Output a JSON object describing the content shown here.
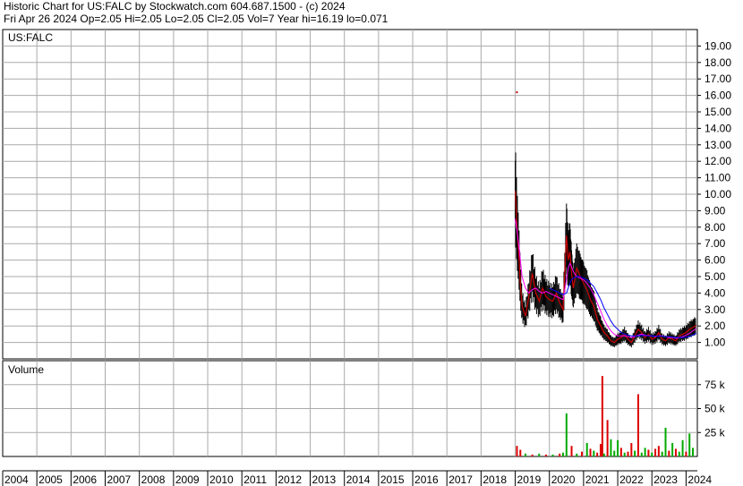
{
  "header": {
    "line1": "Historic Chart for US:FALC by Stockwatch.com 604.687.1500 - (c) 2024",
    "line2": "Fri Apr 26 2024   Op=2.05  Hi=2.05  Lo=2.05  Cl=2.05  Vol=7   Year hi=16.19  lo=0.071"
  },
  "chart_data": [
    {
      "type": "line",
      "title": "US:FALC",
      "ylim": [
        0,
        20
      ],
      "yticks": [
        "1.00",
        "2.00",
        "3.00",
        "4.00",
        "5.00",
        "6.00",
        "7.00",
        "8.00",
        "9.00",
        "10.00",
        "11.00",
        "12.00",
        "13.00",
        "14.00",
        "15.00",
        "16.00",
        "17.00",
        "18.00",
        "19.00"
      ],
      "x": [
        2019.0,
        2019.05,
        2019.1,
        2019.15,
        2019.2,
        2019.3,
        2019.4,
        2019.5,
        2019.6,
        2019.7,
        2019.8,
        2019.9,
        2020.0,
        2020.1,
        2020.2,
        2020.3,
        2020.4,
        2020.5,
        2020.55,
        2020.6,
        2020.65,
        2020.7,
        2020.8,
        2020.9,
        2021.0,
        2021.1,
        2021.2,
        2021.3,
        2021.4,
        2021.5,
        2021.6,
        2021.7,
        2021.8,
        2021.9,
        2022.0,
        2022.1,
        2022.2,
        2022.3,
        2022.4,
        2022.5,
        2022.6,
        2022.7,
        2022.8,
        2022.9,
        2023.0,
        2023.1,
        2023.2,
        2023.3,
        2023.4,
        2023.5,
        2023.6,
        2023.7,
        2023.8,
        2023.9,
        2024.0,
        2024.1,
        2024.2,
        2024.3
      ],
      "series": [
        {
          "values": [
            10.2,
            8.0,
            6.5,
            4.5,
            3.2,
            2.6,
            3.8,
            5.2,
            4.0,
            3.5,
            4.3,
            3.8,
            3.6,
            3.5,
            4.0,
            3.4,
            3.0,
            7.5,
            6.0,
            6.5,
            5.2,
            4.3,
            5.5,
            5.0,
            4.6,
            4.2,
            3.6,
            3.2,
            2.4,
            2.0,
            1.6,
            1.4,
            1.1,
            1.0,
            1.2,
            1.3,
            1.5,
            1.2,
            1.0,
            1.4,
            1.8,
            1.6,
            1.3,
            1.5,
            1.2,
            1.3,
            1.6,
            1.2,
            1.1,
            1.3,
            1.2,
            1.1,
            1.4,
            1.5,
            1.6,
            1.8,
            1.9,
            2.05
          ]
        },
        {
          "values": [
            8.5,
            7.8,
            7.0,
            6.0,
            5.0,
            4.3,
            4.0,
            4.2,
            4.3,
            4.1,
            4.0,
            4.1,
            4.0,
            3.9,
            3.8,
            3.7,
            3.6,
            4.8,
            5.5,
            5.8,
            5.6,
            5.3,
            5.0,
            4.9,
            4.8,
            4.6,
            4.3,
            3.9,
            3.4,
            2.9,
            2.4,
            2.0,
            1.7,
            1.5,
            1.4,
            1.4,
            1.4,
            1.35,
            1.3,
            1.35,
            1.45,
            1.5,
            1.45,
            1.4,
            1.4,
            1.35,
            1.4,
            1.4,
            1.35,
            1.3,
            1.3,
            1.25,
            1.3,
            1.35,
            1.45,
            1.55,
            1.7,
            1.85
          ]
        },
        {
          "values": [
            null,
            null,
            null,
            null,
            null,
            null,
            null,
            null,
            null,
            null,
            null,
            null,
            4.3,
            4.2,
            4.1,
            4.0,
            3.9,
            4.0,
            4.3,
            4.6,
            4.8,
            4.9,
            5.0,
            5.0,
            4.9,
            4.8,
            4.6,
            4.4,
            4.0,
            3.6,
            3.1,
            2.7,
            2.3,
            2.0,
            1.8,
            1.6,
            1.5,
            1.45,
            1.4,
            1.4,
            1.4,
            1.42,
            1.42,
            1.4,
            1.4,
            1.38,
            1.38,
            1.38,
            1.36,
            1.34,
            1.32,
            1.3,
            1.3,
            1.3,
            1.32,
            1.36,
            1.45,
            1.55
          ]
        }
      ],
      "outliers": [
        {
          "x": 2019.05,
          "y": 16.19
        }
      ]
    },
    {
      "type": "bar",
      "title": "Volume",
      "ylim": [
        0,
        100
      ],
      "yticks": [
        "25 k",
        "50 k",
        "75 k"
      ],
      "x": [
        2019.05,
        2019.15,
        2019.3,
        2019.5,
        2019.7,
        2019.9,
        2020.1,
        2020.3,
        2020.4,
        2020.5,
        2020.65,
        2020.8,
        2020.95,
        2021.1,
        2021.2,
        2021.3,
        2021.4,
        2021.5,
        2021.55,
        2021.6,
        2021.7,
        2021.8,
        2021.9,
        2022.0,
        2022.1,
        2022.2,
        2022.3,
        2022.4,
        2022.5,
        2022.6,
        2022.7,
        2022.8,
        2022.9,
        2023.0,
        2023.1,
        2023.2,
        2023.3,
        2023.4,
        2023.5,
        2023.6,
        2023.7,
        2023.8,
        2023.9,
        2024.0,
        2024.1,
        2024.2
      ],
      "values": [
        11,
        7,
        3,
        2,
        3,
        2,
        2,
        3,
        4,
        45,
        11,
        3,
        5,
        14,
        8,
        6,
        4,
        13,
        84,
        3,
        38,
        18,
        6,
        17,
        9,
        4,
        5,
        14,
        6,
        65,
        4,
        9,
        7,
        4,
        8,
        11,
        5,
        30,
        6,
        14,
        8,
        5,
        17,
        5,
        24,
        9
      ],
      "up": [
        false,
        false,
        true,
        false,
        true,
        false,
        true,
        false,
        true,
        true,
        false,
        true,
        false,
        true,
        false,
        true,
        false,
        false,
        false,
        true,
        false,
        true,
        true,
        true,
        false,
        true,
        false,
        false,
        true,
        false,
        true,
        true,
        false,
        true,
        false,
        false,
        true,
        true,
        false,
        true,
        false,
        true,
        true,
        false,
        true,
        true
      ]
    }
  ],
  "x_axis": {
    "years": [
      "2004",
      "2005",
      "2006",
      "2007",
      "2008",
      "2009",
      "2010",
      "2011",
      "2012",
      "2013",
      "2014",
      "2015",
      "2016",
      "2017",
      "2018",
      "2019",
      "2020",
      "2021",
      "2022",
      "2023",
      "2024"
    ],
    "range": [
      2004.0,
      2024.33
    ]
  },
  "colors": {
    "grid": "#aaaaaa",
    "price_line": "#cc0000",
    "ma_short": "#ff00ff",
    "ma_long": "#0000ff",
    "candle": "#000000",
    "vol_up": "#00aa00",
    "vol_down": "#dd0000"
  }
}
